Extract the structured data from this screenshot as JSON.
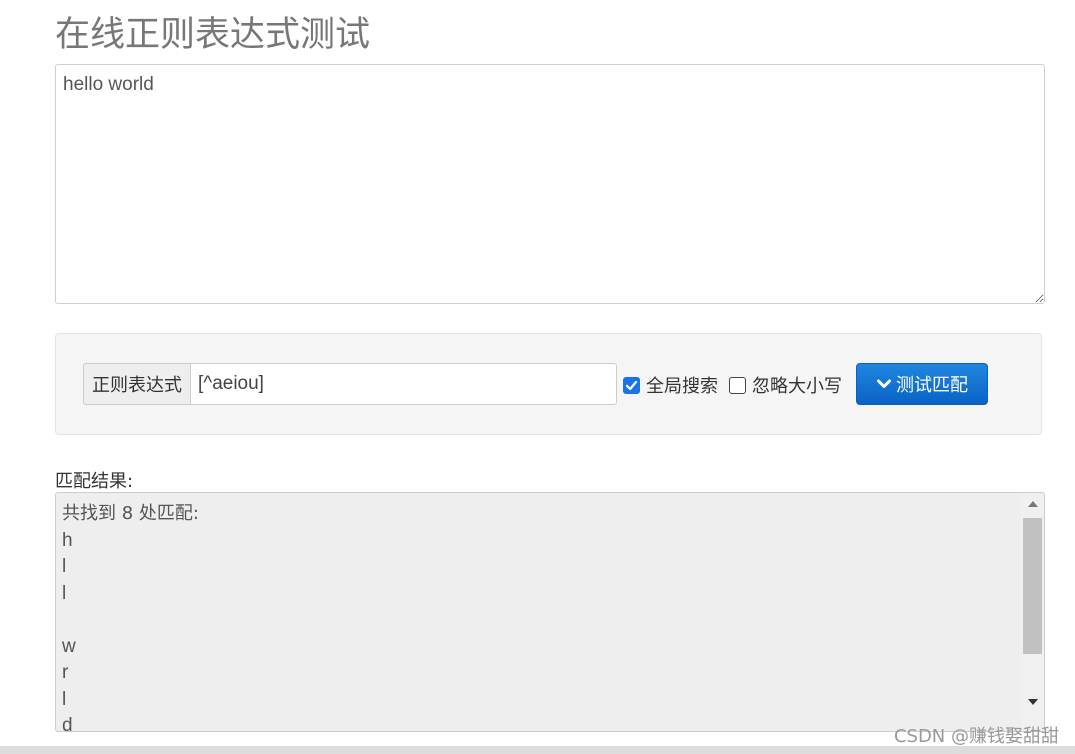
{
  "page": {
    "title": "在线正则表达式测试"
  },
  "source": {
    "text": "hello world"
  },
  "controls": {
    "regex_label": "正则表达式",
    "regex_value": "[^aeiou]",
    "global_label": "全局搜索",
    "global_checked": true,
    "ignore_case_label": "忽略大小写",
    "ignore_case_checked": false,
    "test_button_label": "测试匹配",
    "test_button_icon": "chevron-down-icon"
  },
  "result": {
    "label": "匹配结果:",
    "header": "共找到 8 处匹配:",
    "matches": [
      "h",
      "l",
      "l",
      " ",
      "w",
      "r",
      "l",
      "d"
    ]
  },
  "colors": {
    "button_top": "#1f86e0",
    "button_bottom": "#0a63c5",
    "checkbox_on": "#1a73e8"
  },
  "watermark": {
    "text": "CSDN @赚钱娶甜甜"
  }
}
